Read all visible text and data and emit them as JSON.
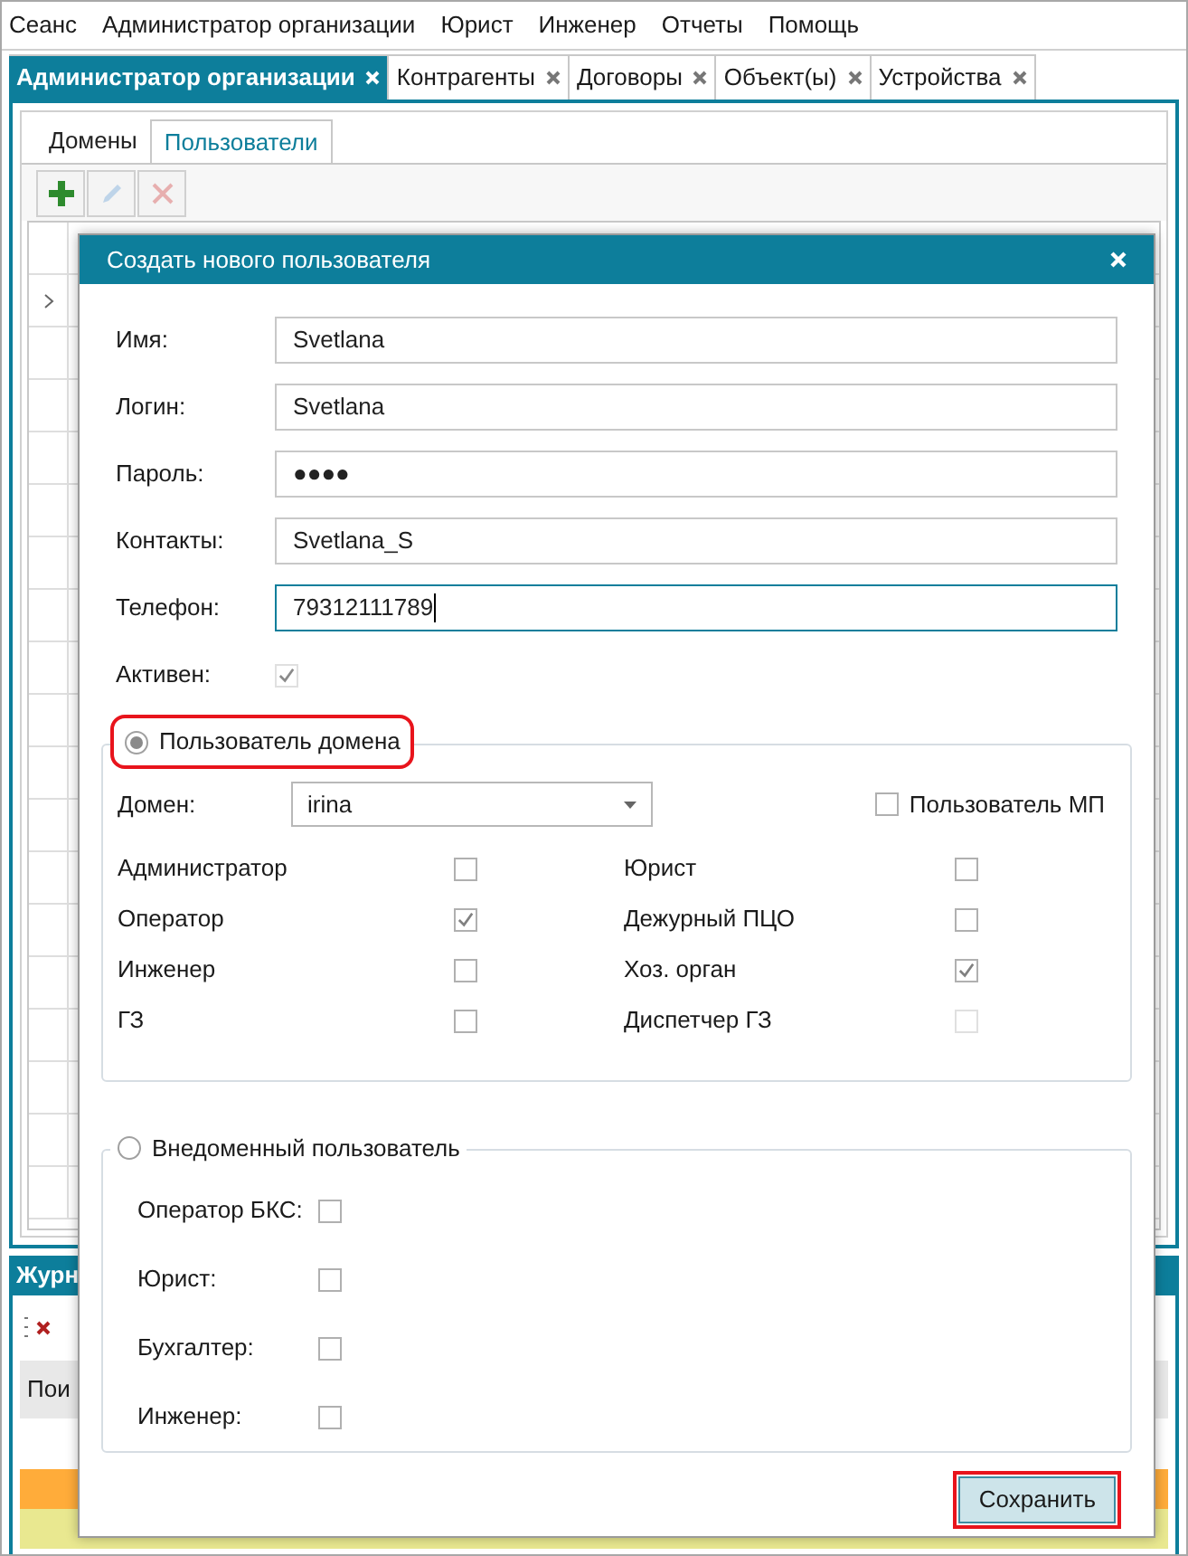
{
  "menu": [
    "Сеанс",
    "Администратор организации",
    "Юрист",
    "Инженер",
    "Отчеты",
    "Помощь"
  ],
  "tabs": [
    {
      "label": "Администратор организации",
      "selected": true
    },
    {
      "label": "Контрагенты",
      "selected": false
    },
    {
      "label": "Договоры",
      "selected": false
    },
    {
      "label": "Объект(ы)",
      "selected": false
    },
    {
      "label": "Устройства",
      "selected": false
    }
  ],
  "subtabs": [
    {
      "label": "Домены",
      "selected": false
    },
    {
      "label": "Пользователи",
      "selected": true
    }
  ],
  "toolbar": [
    {
      "kind": "add",
      "disabled": false
    },
    {
      "kind": "edit",
      "disabled": true
    },
    {
      "kind": "delete",
      "disabled": true
    }
  ],
  "journal": {
    "title": "Журн",
    "column_1": "Пои"
  },
  "dialog": {
    "title": "Создать нового пользователя",
    "fields": [
      {
        "label": "Имя:",
        "value": "Svetlana",
        "focused": false
      },
      {
        "label": "Логин:",
        "value": "Svetlana",
        "focused": false
      },
      {
        "label": "Пароль:",
        "value": "●●●●",
        "focused": false
      },
      {
        "label": "Контакты:",
        "value": "Svetlana_S",
        "focused": false
      },
      {
        "label": "Телефон:",
        "value": "79312111789",
        "focused": true
      }
    ],
    "active": {
      "label": "Активен:",
      "checked": true,
      "disabled": true
    },
    "domain_group": {
      "label": "Пользователь домена",
      "selected": true,
      "highlighted": true,
      "domain_label": "Домен:",
      "domain_value": "irina",
      "mp": {
        "label": "Пользователь МП",
        "checked": false
      },
      "roles": [
        {
          "label": "Администратор",
          "checked": false,
          "disabled": false
        },
        {
          "label": "Юрист",
          "checked": false,
          "disabled": false
        },
        {
          "label": "Оператор",
          "checked": true,
          "disabled": false
        },
        {
          "label": "Дежурный ПЦО",
          "checked": false,
          "disabled": false
        },
        {
          "label": "Инженер",
          "checked": false,
          "disabled": false
        },
        {
          "label": "Хоз. орган",
          "checked": true,
          "disabled": false
        },
        {
          "label": "ГЗ",
          "checked": false,
          "disabled": false
        },
        {
          "label": "Диспетчер ГЗ",
          "checked": false,
          "disabled": true
        }
      ]
    },
    "external_group": {
      "label": "Внедоменный пользователь",
      "selected": false,
      "roles": [
        {
          "label": "Оператор БКС:",
          "checked": false
        },
        {
          "label": "Юрист:",
          "checked": false
        },
        {
          "label": "Бухгалтер:",
          "checked": false
        },
        {
          "label": "Инженер:",
          "checked": false
        }
      ]
    },
    "save_button": {
      "label": "Сохранить",
      "highlighted": true
    }
  }
}
